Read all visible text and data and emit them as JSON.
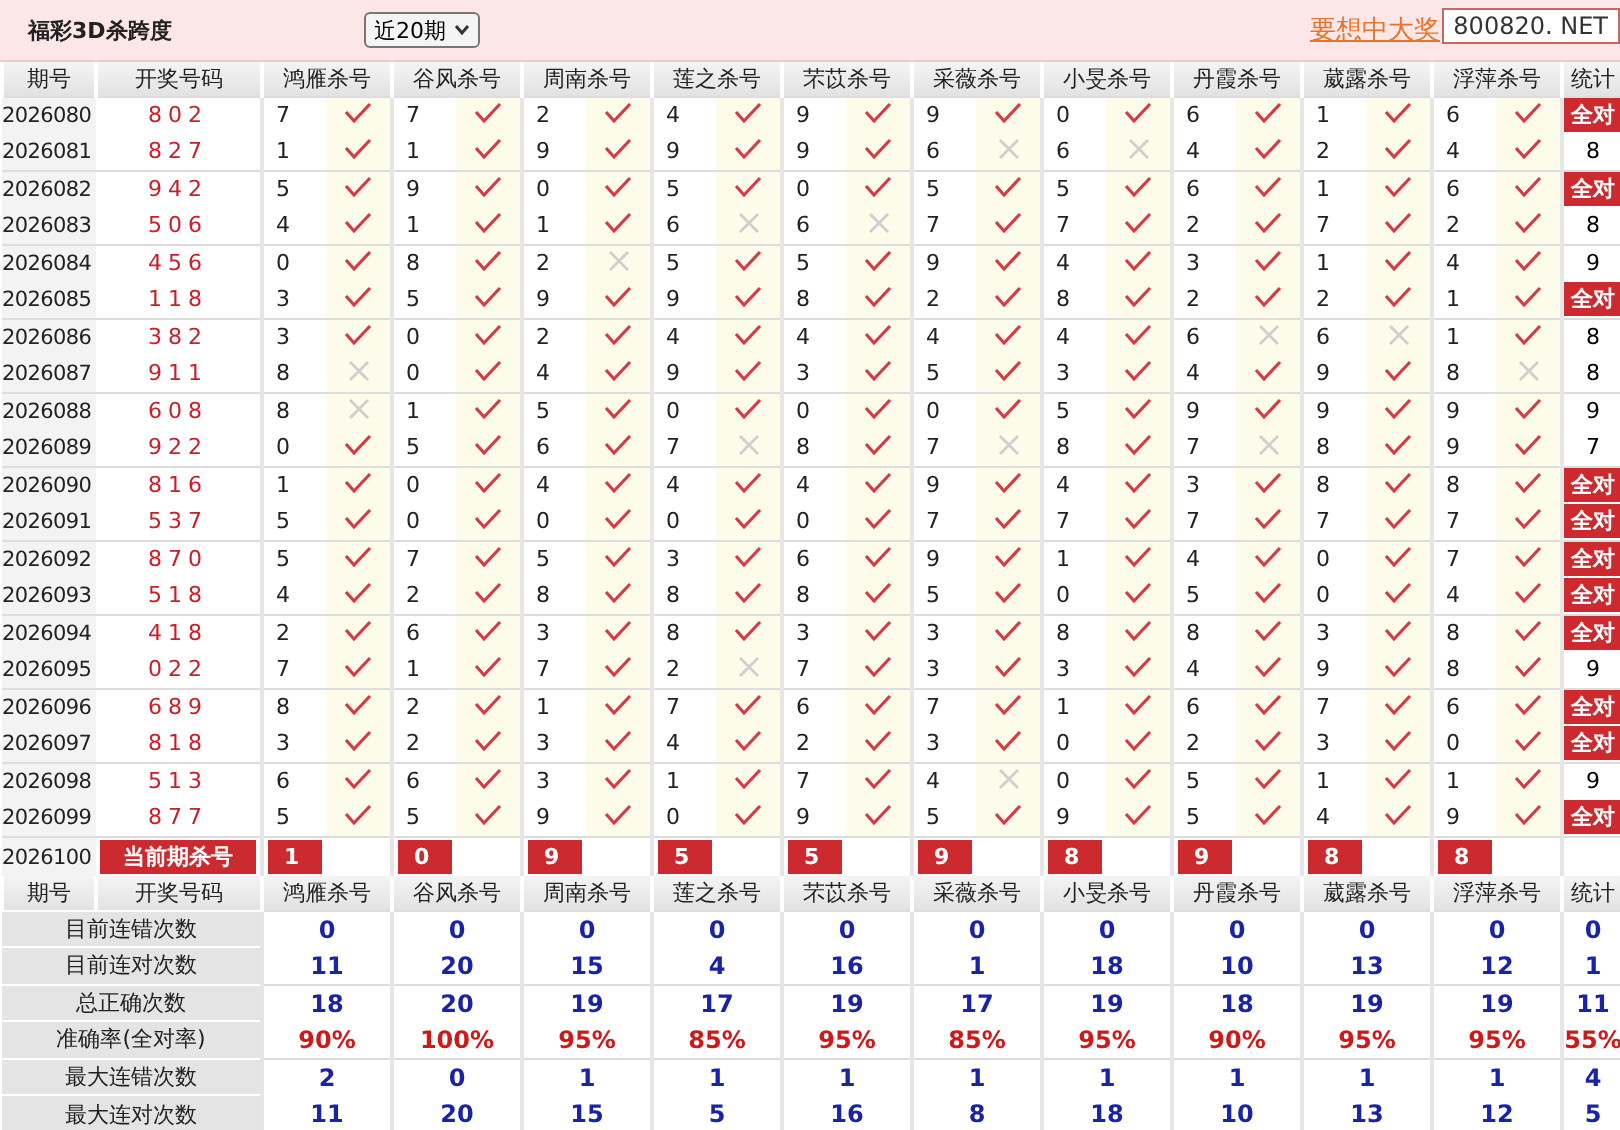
{
  "title": "福彩3D杀跨度",
  "period_select": {
    "value": "近20期"
  },
  "promo_link": "要想中大奖",
  "site_badge": "800820. NET",
  "header": {
    "period": "期号",
    "draw": "开奖号码",
    "experts": [
      "鸿雁杀号",
      "谷风杀号",
      "周南杀号",
      "莲之杀号",
      "芣苡杀号",
      "采薇杀号",
      "小旻杀号",
      "丹霞杀号",
      "葳露杀号",
      "浮萍杀号"
    ],
    "stat": "统计"
  },
  "rows": [
    {
      "period": "2026080",
      "draw": "802",
      "picks": [
        {
          "value": "7",
          "ok": true
        },
        {
          "value": "7",
          "ok": true
        },
        {
          "value": "2",
          "ok": true
        },
        {
          "value": "4",
          "ok": true
        },
        {
          "value": "9",
          "ok": true
        },
        {
          "value": "9",
          "ok": true
        },
        {
          "value": "0",
          "ok": true
        },
        {
          "value": "6",
          "ok": true
        },
        {
          "value": "1",
          "ok": true
        },
        {
          "value": "6",
          "ok": true
        }
      ],
      "stat": {
        "text": "全对",
        "kind": "badge"
      }
    },
    {
      "period": "2026081",
      "draw": "827",
      "picks": [
        {
          "value": "1",
          "ok": true
        },
        {
          "value": "1",
          "ok": true
        },
        {
          "value": "9",
          "ok": true
        },
        {
          "value": "9",
          "ok": true
        },
        {
          "value": "9",
          "ok": true
        },
        {
          "value": "6",
          "ok": false
        },
        {
          "value": "6",
          "ok": false
        },
        {
          "value": "4",
          "ok": true
        },
        {
          "value": "2",
          "ok": true
        },
        {
          "value": "4",
          "ok": true
        }
      ],
      "stat": {
        "text": "8",
        "kind": "count"
      }
    },
    {
      "period": "2026082",
      "draw": "942",
      "picks": [
        {
          "value": "5",
          "ok": true
        },
        {
          "value": "9",
          "ok": true
        },
        {
          "value": "0",
          "ok": true
        },
        {
          "value": "5",
          "ok": true
        },
        {
          "value": "0",
          "ok": true
        },
        {
          "value": "5",
          "ok": true
        },
        {
          "value": "5",
          "ok": true
        },
        {
          "value": "6",
          "ok": true
        },
        {
          "value": "1",
          "ok": true
        },
        {
          "value": "6",
          "ok": true
        }
      ],
      "stat": {
        "text": "全对",
        "kind": "badge"
      }
    },
    {
      "period": "2026083",
      "draw": "506",
      "picks": [
        {
          "value": "4",
          "ok": true
        },
        {
          "value": "1",
          "ok": true
        },
        {
          "value": "1",
          "ok": true
        },
        {
          "value": "6",
          "ok": false
        },
        {
          "value": "6",
          "ok": false
        },
        {
          "value": "7",
          "ok": true
        },
        {
          "value": "7",
          "ok": true
        },
        {
          "value": "2",
          "ok": true
        },
        {
          "value": "7",
          "ok": true
        },
        {
          "value": "2",
          "ok": true
        }
      ],
      "stat": {
        "text": "8",
        "kind": "count"
      }
    },
    {
      "period": "2026084",
      "draw": "456",
      "picks": [
        {
          "value": "0",
          "ok": true
        },
        {
          "value": "8",
          "ok": true
        },
        {
          "value": "2",
          "ok": false
        },
        {
          "value": "5",
          "ok": true
        },
        {
          "value": "5",
          "ok": true
        },
        {
          "value": "9",
          "ok": true
        },
        {
          "value": "4",
          "ok": true
        },
        {
          "value": "3",
          "ok": true
        },
        {
          "value": "1",
          "ok": true
        },
        {
          "value": "4",
          "ok": true
        }
      ],
      "stat": {
        "text": "9",
        "kind": "count"
      }
    },
    {
      "period": "2026085",
      "draw": "118",
      "picks": [
        {
          "value": "3",
          "ok": true
        },
        {
          "value": "5",
          "ok": true
        },
        {
          "value": "9",
          "ok": true
        },
        {
          "value": "9",
          "ok": true
        },
        {
          "value": "8",
          "ok": true
        },
        {
          "value": "2",
          "ok": true
        },
        {
          "value": "8",
          "ok": true
        },
        {
          "value": "2",
          "ok": true
        },
        {
          "value": "2",
          "ok": true
        },
        {
          "value": "1",
          "ok": true
        }
      ],
      "stat": {
        "text": "全对",
        "kind": "badge"
      }
    },
    {
      "period": "2026086",
      "draw": "382",
      "picks": [
        {
          "value": "3",
          "ok": true
        },
        {
          "value": "0",
          "ok": true
        },
        {
          "value": "2",
          "ok": true
        },
        {
          "value": "4",
          "ok": true
        },
        {
          "value": "4",
          "ok": true
        },
        {
          "value": "4",
          "ok": true
        },
        {
          "value": "4",
          "ok": true
        },
        {
          "value": "6",
          "ok": false
        },
        {
          "value": "6",
          "ok": false
        },
        {
          "value": "1",
          "ok": true
        }
      ],
      "stat": {
        "text": "8",
        "kind": "count"
      }
    },
    {
      "period": "2026087",
      "draw": "911",
      "picks": [
        {
          "value": "8",
          "ok": false
        },
        {
          "value": "0",
          "ok": true
        },
        {
          "value": "4",
          "ok": true
        },
        {
          "value": "9",
          "ok": true
        },
        {
          "value": "3",
          "ok": true
        },
        {
          "value": "5",
          "ok": true
        },
        {
          "value": "3",
          "ok": true
        },
        {
          "value": "4",
          "ok": true
        },
        {
          "value": "9",
          "ok": true
        },
        {
          "value": "8",
          "ok": false
        }
      ],
      "stat": {
        "text": "8",
        "kind": "count"
      }
    },
    {
      "period": "2026088",
      "draw": "608",
      "picks": [
        {
          "value": "8",
          "ok": false
        },
        {
          "value": "1",
          "ok": true
        },
        {
          "value": "5",
          "ok": true
        },
        {
          "value": "0",
          "ok": true
        },
        {
          "value": "0",
          "ok": true
        },
        {
          "value": "0",
          "ok": true
        },
        {
          "value": "5",
          "ok": true
        },
        {
          "value": "9",
          "ok": true
        },
        {
          "value": "9",
          "ok": true
        },
        {
          "value": "9",
          "ok": true
        }
      ],
      "stat": {
        "text": "9",
        "kind": "count"
      }
    },
    {
      "period": "2026089",
      "draw": "922",
      "picks": [
        {
          "value": "0",
          "ok": true
        },
        {
          "value": "5",
          "ok": true
        },
        {
          "value": "6",
          "ok": true
        },
        {
          "value": "7",
          "ok": false
        },
        {
          "value": "8",
          "ok": true
        },
        {
          "value": "7",
          "ok": false
        },
        {
          "value": "8",
          "ok": true
        },
        {
          "value": "7",
          "ok": false
        },
        {
          "value": "8",
          "ok": true
        },
        {
          "value": "9",
          "ok": true
        }
      ],
      "stat": {
        "text": "7",
        "kind": "count"
      }
    },
    {
      "period": "2026090",
      "draw": "816",
      "picks": [
        {
          "value": "1",
          "ok": true
        },
        {
          "value": "0",
          "ok": true
        },
        {
          "value": "4",
          "ok": true
        },
        {
          "value": "4",
          "ok": true
        },
        {
          "value": "4",
          "ok": true
        },
        {
          "value": "9",
          "ok": true
        },
        {
          "value": "4",
          "ok": true
        },
        {
          "value": "3",
          "ok": true
        },
        {
          "value": "8",
          "ok": true
        },
        {
          "value": "8",
          "ok": true
        }
      ],
      "stat": {
        "text": "全对",
        "kind": "badge"
      }
    },
    {
      "period": "2026091",
      "draw": "537",
      "picks": [
        {
          "value": "5",
          "ok": true
        },
        {
          "value": "0",
          "ok": true
        },
        {
          "value": "0",
          "ok": true
        },
        {
          "value": "0",
          "ok": true
        },
        {
          "value": "0",
          "ok": true
        },
        {
          "value": "7",
          "ok": true
        },
        {
          "value": "7",
          "ok": true
        },
        {
          "value": "7",
          "ok": true
        },
        {
          "value": "7",
          "ok": true
        },
        {
          "value": "7",
          "ok": true
        }
      ],
      "stat": {
        "text": "全对",
        "kind": "badge"
      }
    },
    {
      "period": "2026092",
      "draw": "870",
      "picks": [
        {
          "value": "5",
          "ok": true
        },
        {
          "value": "7",
          "ok": true
        },
        {
          "value": "5",
          "ok": true
        },
        {
          "value": "3",
          "ok": true
        },
        {
          "value": "6",
          "ok": true
        },
        {
          "value": "9",
          "ok": true
        },
        {
          "value": "1",
          "ok": true
        },
        {
          "value": "4",
          "ok": true
        },
        {
          "value": "0",
          "ok": true
        },
        {
          "value": "7",
          "ok": true
        }
      ],
      "stat": {
        "text": "全对",
        "kind": "badge"
      }
    },
    {
      "period": "2026093",
      "draw": "518",
      "picks": [
        {
          "value": "4",
          "ok": true
        },
        {
          "value": "2",
          "ok": true
        },
        {
          "value": "8",
          "ok": true
        },
        {
          "value": "8",
          "ok": true
        },
        {
          "value": "8",
          "ok": true
        },
        {
          "value": "5",
          "ok": true
        },
        {
          "value": "0",
          "ok": true
        },
        {
          "value": "5",
          "ok": true
        },
        {
          "value": "0",
          "ok": true
        },
        {
          "value": "4",
          "ok": true
        }
      ],
      "stat": {
        "text": "全对",
        "kind": "badge"
      }
    },
    {
      "period": "2026094",
      "draw": "418",
      "picks": [
        {
          "value": "2",
          "ok": true
        },
        {
          "value": "6",
          "ok": true
        },
        {
          "value": "3",
          "ok": true
        },
        {
          "value": "8",
          "ok": true
        },
        {
          "value": "3",
          "ok": true
        },
        {
          "value": "3",
          "ok": true
        },
        {
          "value": "8",
          "ok": true
        },
        {
          "value": "8",
          "ok": true
        },
        {
          "value": "3",
          "ok": true
        },
        {
          "value": "8",
          "ok": true
        }
      ],
      "stat": {
        "text": "全对",
        "kind": "badge"
      }
    },
    {
      "period": "2026095",
      "draw": "022",
      "picks": [
        {
          "value": "7",
          "ok": true
        },
        {
          "value": "1",
          "ok": true
        },
        {
          "value": "7",
          "ok": true
        },
        {
          "value": "2",
          "ok": false
        },
        {
          "value": "7",
          "ok": true
        },
        {
          "value": "3",
          "ok": true
        },
        {
          "value": "3",
          "ok": true
        },
        {
          "value": "4",
          "ok": true
        },
        {
          "value": "9",
          "ok": true
        },
        {
          "value": "8",
          "ok": true
        }
      ],
      "stat": {
        "text": "9",
        "kind": "count"
      }
    },
    {
      "period": "2026096",
      "draw": "689",
      "picks": [
        {
          "value": "8",
          "ok": true
        },
        {
          "value": "2",
          "ok": true
        },
        {
          "value": "1",
          "ok": true
        },
        {
          "value": "7",
          "ok": true
        },
        {
          "value": "6",
          "ok": true
        },
        {
          "value": "7",
          "ok": true
        },
        {
          "value": "1",
          "ok": true
        },
        {
          "value": "6",
          "ok": true
        },
        {
          "value": "7",
          "ok": true
        },
        {
          "value": "6",
          "ok": true
        }
      ],
      "stat": {
        "text": "全对",
        "kind": "badge"
      }
    },
    {
      "period": "2026097",
      "draw": "818",
      "picks": [
        {
          "value": "3",
          "ok": true
        },
        {
          "value": "2",
          "ok": true
        },
        {
          "value": "3",
          "ok": true
        },
        {
          "value": "4",
          "ok": true
        },
        {
          "value": "2",
          "ok": true
        },
        {
          "value": "3",
          "ok": true
        },
        {
          "value": "0",
          "ok": true
        },
        {
          "value": "2",
          "ok": true
        },
        {
          "value": "3",
          "ok": true
        },
        {
          "value": "0",
          "ok": true
        }
      ],
      "stat": {
        "text": "全对",
        "kind": "badge"
      }
    },
    {
      "period": "2026098",
      "draw": "513",
      "picks": [
        {
          "value": "6",
          "ok": true
        },
        {
          "value": "6",
          "ok": true
        },
        {
          "value": "3",
          "ok": true
        },
        {
          "value": "1",
          "ok": true
        },
        {
          "value": "7",
          "ok": true
        },
        {
          "value": "4",
          "ok": false
        },
        {
          "value": "0",
          "ok": true
        },
        {
          "value": "5",
          "ok": true
        },
        {
          "value": "1",
          "ok": true
        },
        {
          "value": "1",
          "ok": true
        }
      ],
      "stat": {
        "text": "9",
        "kind": "count"
      }
    },
    {
      "period": "2026099",
      "draw": "877",
      "picks": [
        {
          "value": "5",
          "ok": true
        },
        {
          "value": "5",
          "ok": true
        },
        {
          "value": "9",
          "ok": true
        },
        {
          "value": "0",
          "ok": true
        },
        {
          "value": "9",
          "ok": true
        },
        {
          "value": "5",
          "ok": true
        },
        {
          "value": "9",
          "ok": true
        },
        {
          "value": "5",
          "ok": true
        },
        {
          "value": "4",
          "ok": true
        },
        {
          "value": "9",
          "ok": true
        }
      ],
      "stat": {
        "text": "全对",
        "kind": "badge"
      }
    }
  ],
  "current": {
    "period": "2026100",
    "label": "当前期杀号",
    "picks": [
      "1",
      "0",
      "9",
      "5",
      "5",
      "9",
      "8",
      "9",
      "8",
      "8"
    ]
  },
  "footer_header": {
    "period": "期号",
    "draw": "开奖号码",
    "experts": [
      "鸿雁杀号",
      "谷风杀号",
      "周南杀号",
      "莲之杀号",
      "芣苡杀号",
      "采薇杀号",
      "小旻杀号",
      "丹霞杀号",
      "葳露杀号",
      "浮萍杀号"
    ],
    "stat": "统计"
  },
  "stats": [
    {
      "label": "目前连错次数",
      "kind": "count",
      "values": [
        "0",
        "0",
        "0",
        "0",
        "0",
        "0",
        "0",
        "0",
        "0",
        "0",
        "0"
      ]
    },
    {
      "label": "目前连对次数",
      "kind": "count",
      "values": [
        "11",
        "20",
        "15",
        "4",
        "16",
        "1",
        "18",
        "10",
        "13",
        "12",
        "1"
      ]
    },
    {
      "label": "总正确次数",
      "kind": "count",
      "values": [
        "18",
        "20",
        "19",
        "17",
        "19",
        "17",
        "19",
        "18",
        "19",
        "19",
        "11"
      ]
    },
    {
      "label": "准确率(全对率)",
      "kind": "rate",
      "values": [
        "90%",
        "100%",
        "95%",
        "85%",
        "95%",
        "85%",
        "95%",
        "90%",
        "95%",
        "95%",
        "55%"
      ]
    },
    {
      "label": "最大连错次数",
      "kind": "count",
      "values": [
        "2",
        "0",
        "1",
        "1",
        "1",
        "1",
        "1",
        "1",
        "1",
        "1",
        "4"
      ]
    },
    {
      "label": "最大连对次数",
      "kind": "count",
      "values": [
        "11",
        "20",
        "15",
        "5",
        "16",
        "8",
        "18",
        "10",
        "13",
        "12",
        "5"
      ]
    }
  ]
}
